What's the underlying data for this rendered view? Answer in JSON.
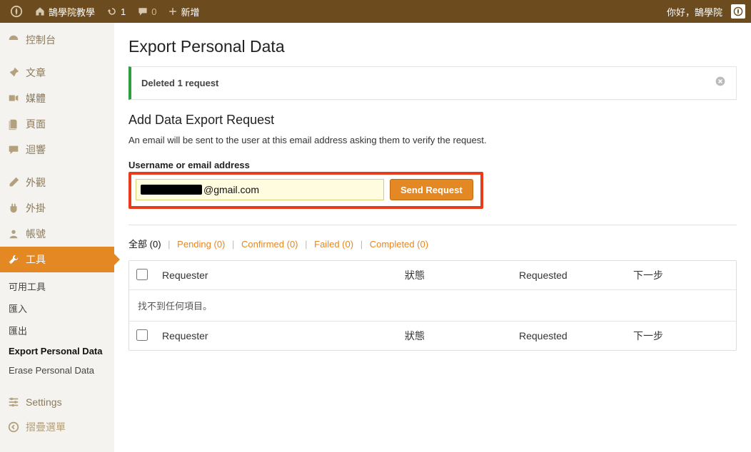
{
  "topbar": {
    "site_name": "鵠學院教學",
    "refresh_count": "1",
    "comments_count": "0",
    "new_label": "新增",
    "greeting": "你好，鵠學院"
  },
  "sidebar": {
    "dashboard": "控制台",
    "posts": "文章",
    "media": "媒體",
    "pages": "頁面",
    "comments": "迴響",
    "appearance": "外觀",
    "plugins": "外掛",
    "users": "帳號",
    "tools": "工具",
    "sub_available": "可用工具",
    "sub_import": "匯入",
    "sub_export": "匯出",
    "sub_export_pd": "Export Personal Data",
    "sub_erase_pd": "Erase Personal Data",
    "settings": "Settings",
    "collapse": "摺疊選單"
  },
  "page": {
    "title": "Export Personal Data",
    "notice": "Deleted 1 request",
    "section_title": "Add Data Export Request",
    "description": "An email will be sent to the user at this email address asking them to verify the request.",
    "field_label": "Username or email address",
    "email_suffix": "@gmail.com",
    "send_button": "Send Request"
  },
  "filters": {
    "all_label": "全部",
    "all_count": "(0)",
    "pending": "Pending (0)",
    "confirmed": "Confirmed (0)",
    "failed": "Failed (0)",
    "completed": "Completed (0)"
  },
  "table": {
    "col_requester": "Requester",
    "col_status": "狀態",
    "col_requested": "Requested",
    "col_next": "下一步",
    "empty": "找不到任何項目。"
  }
}
